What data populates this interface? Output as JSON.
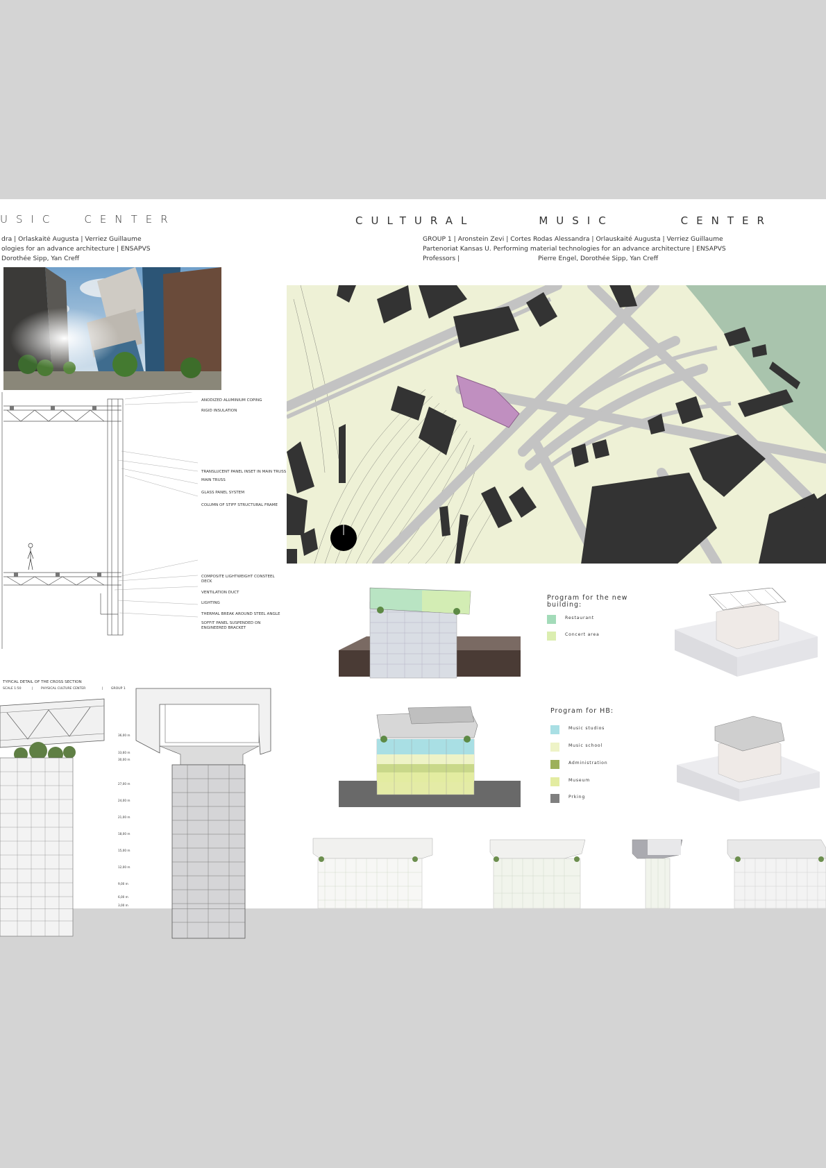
{
  "header": {
    "left_title_w1": "USIC",
    "left_title_w2": "CENTER",
    "main_title_w1": "CULTURAL",
    "main_title_w2": "MUSIC",
    "main_title_w3": "CENTER",
    "left_line1": "dra | Orlaskaitė Augusta |     Verriez Guillaume",
    "left_line2": "ologies for an advance architecture  |  ENSAPVS",
    "left_line3": "Dorothée Sipp, Yan Creff",
    "main_line1": "GROUP 1 | Aronstein Zevi  | Cortes Rodas Alessandra | Orlauskaité Augusta |    Verriez Guillaume",
    "main_line2": "Partenoriat Kansas U. Performing material technologies for an advance architecture  |  ENSAPVS",
    "main_line3_label": "Professors  |",
    "main_line3_names": "Pierre Engel, Dorothée Sipp, Yan Creff"
  },
  "detail_callouts": [
    "ANODIZED ALUMINIUM COPING",
    "RIGID INSULATION",
    "TRANSLUCENT PANEL INSET IN MAIN TRUSS",
    "MAIN TRUSS",
    "GLASS PANEL SYSTEM",
    "COLUMN OF STIFF STRUCTURAL FRAME",
    "COMPOSITE LIGHTWEIGHT CONSTEEL DECK",
    "VENTILATION DUCT",
    "LIGHTING",
    "THERMAL BREAK AROUND STEEL ANGLE",
    "SOFFIT PANEL SUSPENDED ON ENGINEERED BRACKET"
  ],
  "detail_caption": "TYPICAL DETAIL OF THE CROSS SECTION",
  "detail_caption_row": [
    "SCALE 1:50",
    "|",
    "PHYSICAL CULTURE CENTER",
    "|",
    "GROUP 1"
  ],
  "program_new": {
    "title_line1": "Program for the new",
    "title_line2": "building:",
    "items": [
      {
        "label": "Restaurant",
        "color": "#a3dbb9"
      },
      {
        "label": "Concert area",
        "color": "#dbeeb0"
      }
    ]
  },
  "program_hb": {
    "title": "Program for HB:",
    "items": [
      {
        "label": "Music studios",
        "color": "#a9dfe4"
      },
      {
        "label": "Music school",
        "color": "#eef3c7"
      },
      {
        "label": "Administration",
        "color": "#9db05a"
      },
      {
        "label": "Museum",
        "color": "#e3eca1"
      },
      {
        "label": "Prking",
        "color": "#7f7f7f"
      }
    ]
  },
  "level_labels": [
    "36,00 m",
    "33,60 m",
    "30,00 m",
    "27,00 m",
    "24,00 m",
    "21,00 m",
    "18,00 m",
    "15,00 m",
    "12,00 m",
    "9,00 m",
    "6,00 m",
    "3,00 m"
  ],
  "colors": {
    "page_bg": "#d4d4d4",
    "map_ground": "#eef1d6",
    "map_building": "#333333",
    "map_road": "#c3c3c3",
    "map_park": "#a9c4ad",
    "map_site": "#c08fc0"
  }
}
